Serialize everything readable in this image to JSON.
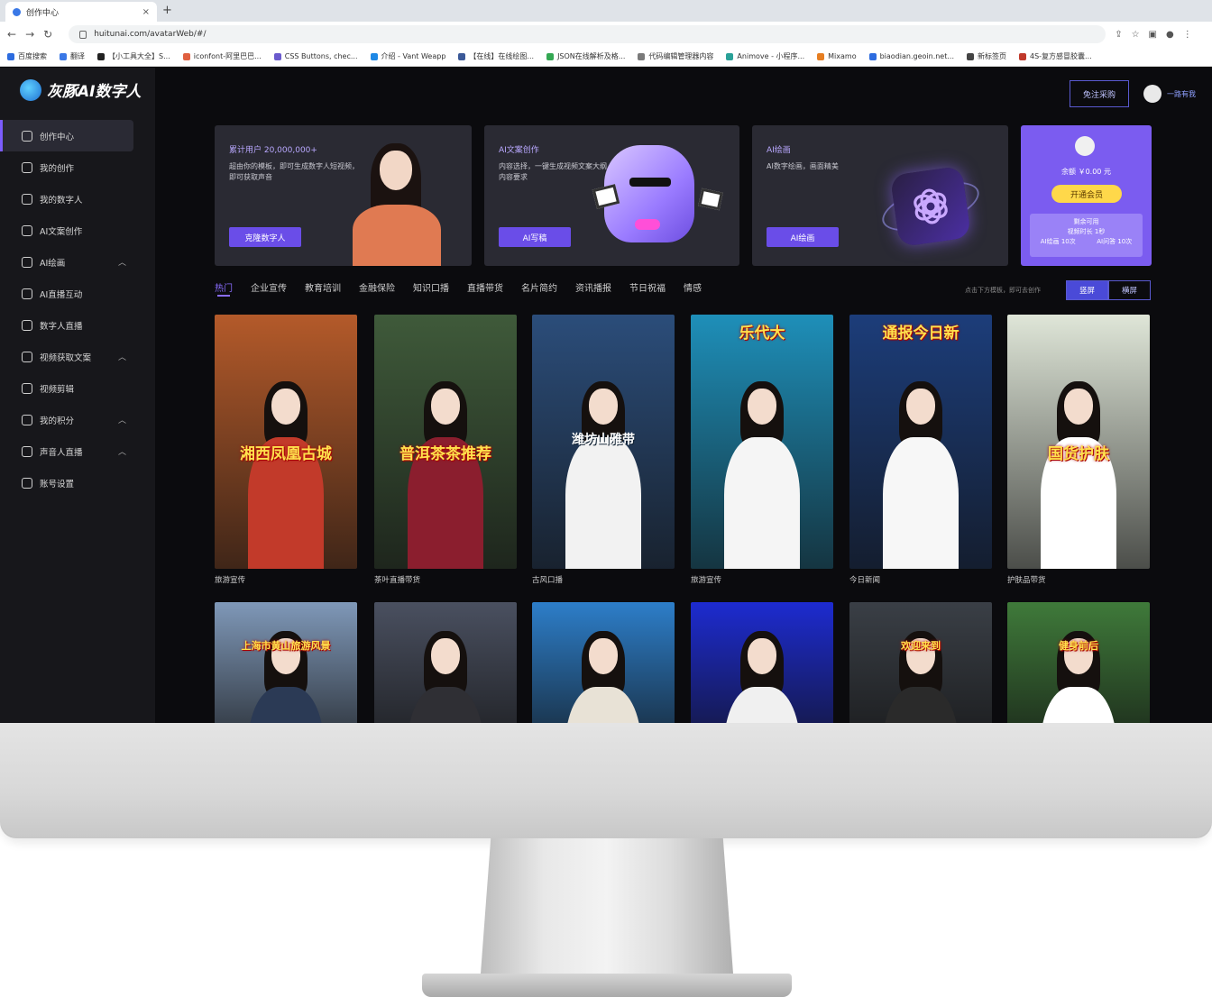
{
  "browser": {
    "tab_title": "创作中心",
    "url": "huitunai.com/avatarWeb/#/",
    "bookmarks": [
      "百度搜索",
      "翻译",
      "【小工具大全】S...",
      "iconfont-阿里巴巴...",
      "CSS Buttons, chec...",
      "介绍 - Vant Weapp",
      "【在线】在线绘图...",
      "JSON在线解析及格...",
      "代码编辑管理器内容",
      "Animove - 小程序...",
      "Mixamo",
      "biaodian.geoin.net...",
      "新标签页",
      "4S-复方感冒胶囊..."
    ]
  },
  "app": {
    "brand": "灰豚AI数字人",
    "open_btn": "免注采购",
    "user_name": "一路有我"
  },
  "sidebar": {
    "items": [
      {
        "label": "创作中心",
        "active": true,
        "expandable": false
      },
      {
        "label": "我的创作",
        "active": false,
        "expandable": false
      },
      {
        "label": "我的数字人",
        "active": false,
        "expandable": false
      },
      {
        "label": "AI文案创作",
        "active": false,
        "expandable": false
      },
      {
        "label": "AI绘画",
        "active": false,
        "expandable": true
      },
      {
        "label": "AI直播互动",
        "active": false,
        "expandable": false
      },
      {
        "label": "数字人直播",
        "active": false,
        "expandable": false
      },
      {
        "label": "视频获取文案",
        "active": false,
        "expandable": true
      },
      {
        "label": "视频剪辑",
        "active": false,
        "expandable": false
      },
      {
        "label": "我的积分",
        "active": false,
        "expandable": true
      },
      {
        "label": "声音人直播",
        "active": false,
        "expandable": true
      },
      {
        "label": "账号设置",
        "active": false,
        "expandable": false
      }
    ]
  },
  "banners": [
    {
      "title": "累计用户 20,000,000+",
      "desc": "超由你的模板，即可生成数字人短视频，即可获取声音",
      "button": "克隆数字人"
    },
    {
      "title": "AI文案创作",
      "desc": "内容选择，一键生成视频文案大纲，解析内容要求",
      "button": "AI写稿"
    },
    {
      "title": "AI绘画",
      "desc": "AI数字绘画，画面精美",
      "button": "AI绘画"
    }
  ],
  "vip": {
    "balance": "余额 ￥0.00 元",
    "button": "开通会员",
    "box_title": "剩余可用",
    "box_line2": "视频时长 1秒",
    "left": "AI绘画 10次",
    "right": "AI问答 10次"
  },
  "categories": [
    "热门",
    "企业宣传",
    "教育培训",
    "金融保险",
    "知识口播",
    "直播带货",
    "名片简约",
    "资讯播报",
    "节日祝福",
    "情感"
  ],
  "sort_note": "点击下方模板，即可去创作",
  "orientation": {
    "vertical": "竖屏",
    "horizontal": "横屏"
  },
  "row1": [
    {
      "caption": "旅游宣传",
      "overlay": "湘西凤凰古城",
      "bg": "#b45a2a",
      "outfit": "#c23a2a"
    },
    {
      "caption": "茶叶直播带货",
      "overlay": "普洱茶茶推荐",
      "bg": "#3f5a3a",
      "outfit": "#8b1e2e"
    },
    {
      "caption": "古风口播",
      "overlay": "潍坊山雅带",
      "bg": "#2b4d7a",
      "outfit": "#f2f2f2"
    },
    {
      "caption": "旅游宣传",
      "overlay": "乐代大",
      "bg": "#1e8fb9",
      "outfit": "#f5f5f5"
    },
    {
      "caption": "今日新闻",
      "overlay": "通报今日新",
      "bg": "#1c3d7a",
      "outfit": "#f7f7f7"
    },
    {
      "caption": "护肤品带货",
      "overlay": "国货护肤",
      "bg": "#dfe6d8",
      "outfit": "#ffffff"
    }
  ],
  "row2": [
    {
      "overlay": "上海市黄山旅游风景",
      "bg": "#7f98b8",
      "outfit": "#2b3a55"
    },
    {
      "overlay": "",
      "bg": "#4a5060",
      "outfit": "#2f2f34"
    },
    {
      "overlay": "",
      "bg": "#2d7ec9",
      "outfit": "#e8e2d6"
    },
    {
      "overlay": "",
      "bg": "#1d2bd0",
      "outfit": "#f0f0f0"
    },
    {
      "overlay": "欢迎来到",
      "bg": "#3a3f46",
      "outfit": "#2a2a2a"
    },
    {
      "overlay": "健身前后",
      "bg": "#3f7a3a",
      "outfit": "#ffffff"
    }
  ],
  "colors": {
    "accent": "#7c5cff",
    "bg": "#0b0b0e",
    "sidebar": "#17171b",
    "vip": "#7b5cf0",
    "vip_btn": "#ffd84a"
  }
}
